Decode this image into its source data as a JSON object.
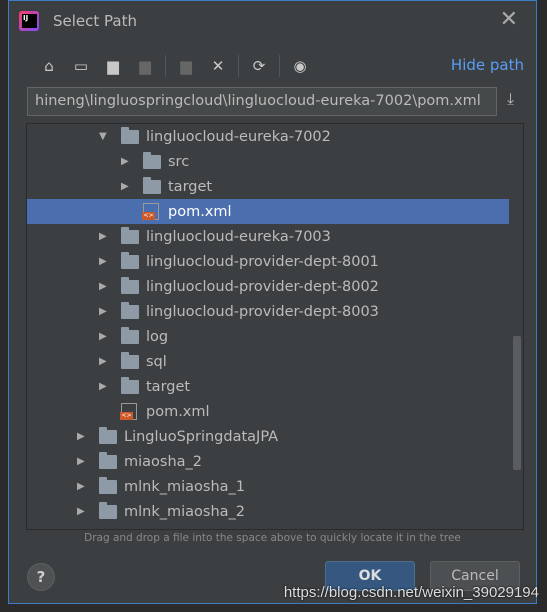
{
  "dialog": {
    "title": "Select Path",
    "hide_path": "Hide path",
    "path_value": "hineng\\lingluospringcloud\\lingluocloud-eureka-7002\\pom.xml",
    "hint": "Drag and drop a file into the space above to quickly locate it in the tree",
    "help": "?",
    "ok": "OK",
    "cancel": "Cancel"
  },
  "toolbar": [
    {
      "icon": "home-icon",
      "glyph": "⌂",
      "enabled": true
    },
    {
      "icon": "desktop-icon",
      "glyph": "▭",
      "enabled": true
    },
    {
      "icon": "project-folder-icon",
      "glyph": "▆",
      "enabled": true
    },
    {
      "icon": "module-folder-icon",
      "glyph": "▆",
      "enabled": false
    },
    {
      "icon": "new-folder-icon",
      "glyph": "▆",
      "enabled": false
    },
    {
      "icon": "delete-icon",
      "glyph": "✕",
      "enabled": true
    },
    {
      "icon": "refresh-icon",
      "glyph": "⟳",
      "enabled": true
    },
    {
      "icon": "show-hidden-icon",
      "glyph": "◉",
      "enabled": true
    }
  ],
  "tree": [
    {
      "label": "lingluocloud-eureka-7002",
      "depth": 3,
      "type": "folder",
      "expanded": true
    },
    {
      "label": "src",
      "depth": 4,
      "type": "folder",
      "expanded": false
    },
    {
      "label": "target",
      "depth": 4,
      "type": "folder",
      "expanded": false
    },
    {
      "label": "pom.xml",
      "depth": 4,
      "type": "file",
      "selected": true
    },
    {
      "label": "lingluocloud-eureka-7003",
      "depth": 3,
      "type": "folder",
      "expanded": false
    },
    {
      "label": "lingluocloud-provider-dept-8001",
      "depth": 3,
      "type": "folder",
      "expanded": false
    },
    {
      "label": "lingluocloud-provider-dept-8002",
      "depth": 3,
      "type": "folder",
      "expanded": false
    },
    {
      "label": "lingluocloud-provider-dept-8003",
      "depth": 3,
      "type": "folder",
      "expanded": false
    },
    {
      "label": "log",
      "depth": 3,
      "type": "folder",
      "expanded": false
    },
    {
      "label": "sql",
      "depth": 3,
      "type": "folder",
      "expanded": false
    },
    {
      "label": "target",
      "depth": 3,
      "type": "folder",
      "expanded": false
    },
    {
      "label": "pom.xml",
      "depth": 3,
      "type": "file"
    },
    {
      "label": "LingluoSpringdataJPA",
      "depth": 2,
      "type": "folder",
      "expanded": false
    },
    {
      "label": "miaosha_2",
      "depth": 2,
      "type": "folder",
      "expanded": false
    },
    {
      "label": "mlnk_miaosha_1",
      "depth": 2,
      "type": "folder",
      "expanded": false
    },
    {
      "label": "mlnk_miaosha_2",
      "depth": 2,
      "type": "folder",
      "expanded": false
    }
  ],
  "watermark": "https://blog.csdn.net/weixin_39029194"
}
